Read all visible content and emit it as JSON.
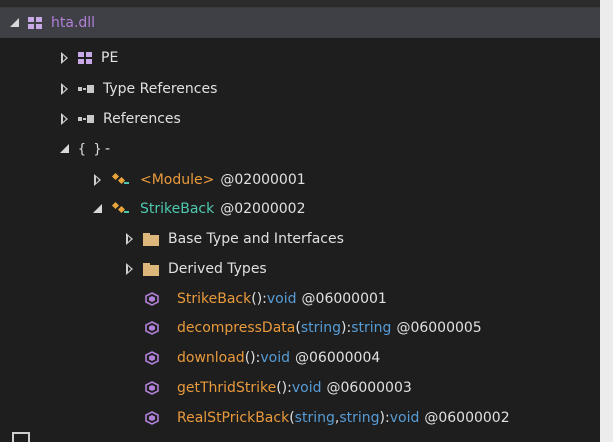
{
  "tree": {
    "root": {
      "label": "hta.dll"
    },
    "pe": {
      "label": "PE"
    },
    "type_refs": {
      "label": "Type References"
    },
    "refs": {
      "label": "References"
    },
    "namespace": {
      "label": "{ }",
      "name": "-"
    },
    "module": {
      "name": "<Module>",
      "token": "@02000001"
    },
    "class": {
      "name": "StrikeBack",
      "token": "@02000002"
    },
    "base_types": {
      "label": "Base Type and Interfaces"
    },
    "derived_types": {
      "label": "Derived Types"
    },
    "methods": [
      {
        "name": "StrikeBack",
        "open": "(",
        "params": [],
        "close": ")",
        "sep": " : ",
        "ret": "void",
        "token": "@06000001"
      },
      {
        "name": "decompressData",
        "open": "(",
        "params": [
          "string"
        ],
        "close": ")",
        "sep": " : ",
        "ret": "string",
        "token": "@06000005"
      },
      {
        "name": "download",
        "open": "(",
        "params": [],
        "close": ")",
        "sep": " : ",
        "ret": "void",
        "token": "@06000004"
      },
      {
        "name": "getThridStrike",
        "open": "(",
        "params": [],
        "close": ")",
        "sep": " : ",
        "ret": "void",
        "token": "@06000003"
      },
      {
        "name": "RealStPrickBack",
        "open": "(",
        "params": [
          "string",
          "string"
        ],
        "param_sep": ", ",
        "close": ")",
        "sep": " : ",
        "ret": "void",
        "token": "@06000002"
      }
    ]
  },
  "colors": {
    "background": "#1e1e1e",
    "selected": "#3f3f46",
    "method_name": "#e89a3c",
    "type_name": "#4ec9b0",
    "keyword": "#569cd6",
    "assembly": "#b180d7"
  }
}
